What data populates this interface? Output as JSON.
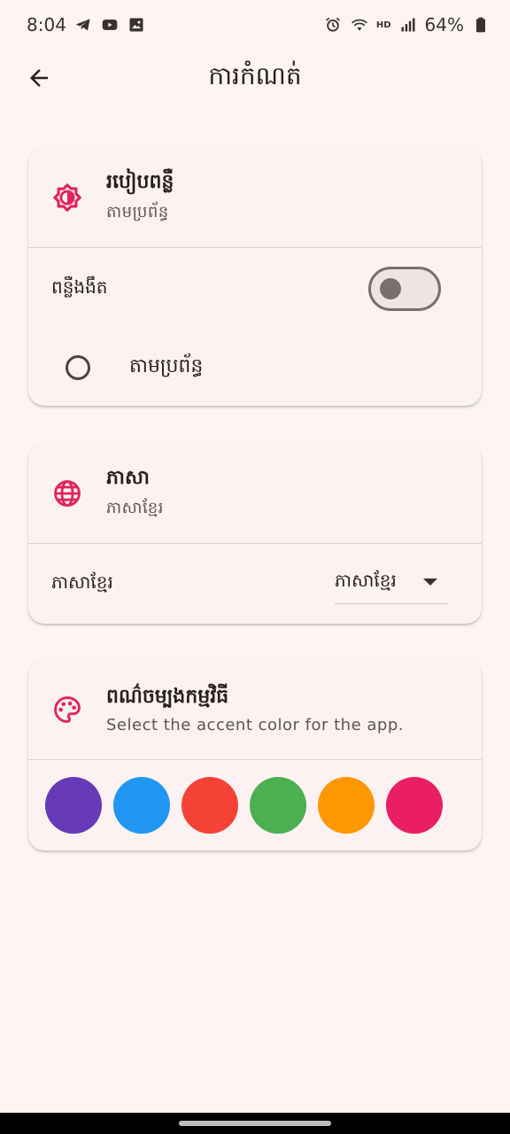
{
  "status_bar": {
    "time": "8:04",
    "battery": "64%",
    "hd": "HD",
    "left_icons": [
      "telegram-icon",
      "youtube-icon",
      "gallery-icon"
    ],
    "right_icons": [
      "alarm-icon",
      "wifi-icon",
      "signal-icon",
      "battery-icon"
    ]
  },
  "app_bar": {
    "title": "ការកំណត់",
    "back_icon": "arrow-back-icon"
  },
  "theme_card": {
    "icon": "brightness-icon",
    "title": "របៀបពន្លឺ",
    "subtitle": "តាមប្រព័ន្ធ",
    "dark_mode_label": "ពន្លឺងងឹត",
    "dark_mode_on": false,
    "system_option_label": "តាមប្រព័ន្ធ"
  },
  "language_card": {
    "icon": "globe-icon",
    "title": "ភាសា",
    "subtitle": "ភាសាខ្មែរ",
    "row_label": "ភាសាខ្មែរ",
    "selected_value": "ភាសាខ្មែរ"
  },
  "color_card": {
    "icon": "palette-icon",
    "title": "ពណ៌ចម្បងកម្មវិធី",
    "subtitle": "Select the accent color for the app.",
    "swatches": [
      {
        "name": "purple",
        "color": "#673ab7"
      },
      {
        "name": "blue",
        "color": "#2196f3"
      },
      {
        "name": "red",
        "color": "#f44336"
      },
      {
        "name": "green",
        "color": "#4caf50"
      },
      {
        "name": "orange",
        "color": "#ff9800"
      },
      {
        "name": "pink",
        "color": "#e91e63"
      }
    ]
  },
  "colors": {
    "accent": "#e0245e",
    "background": "#fdf4f3",
    "card": "#fdf2f2"
  }
}
